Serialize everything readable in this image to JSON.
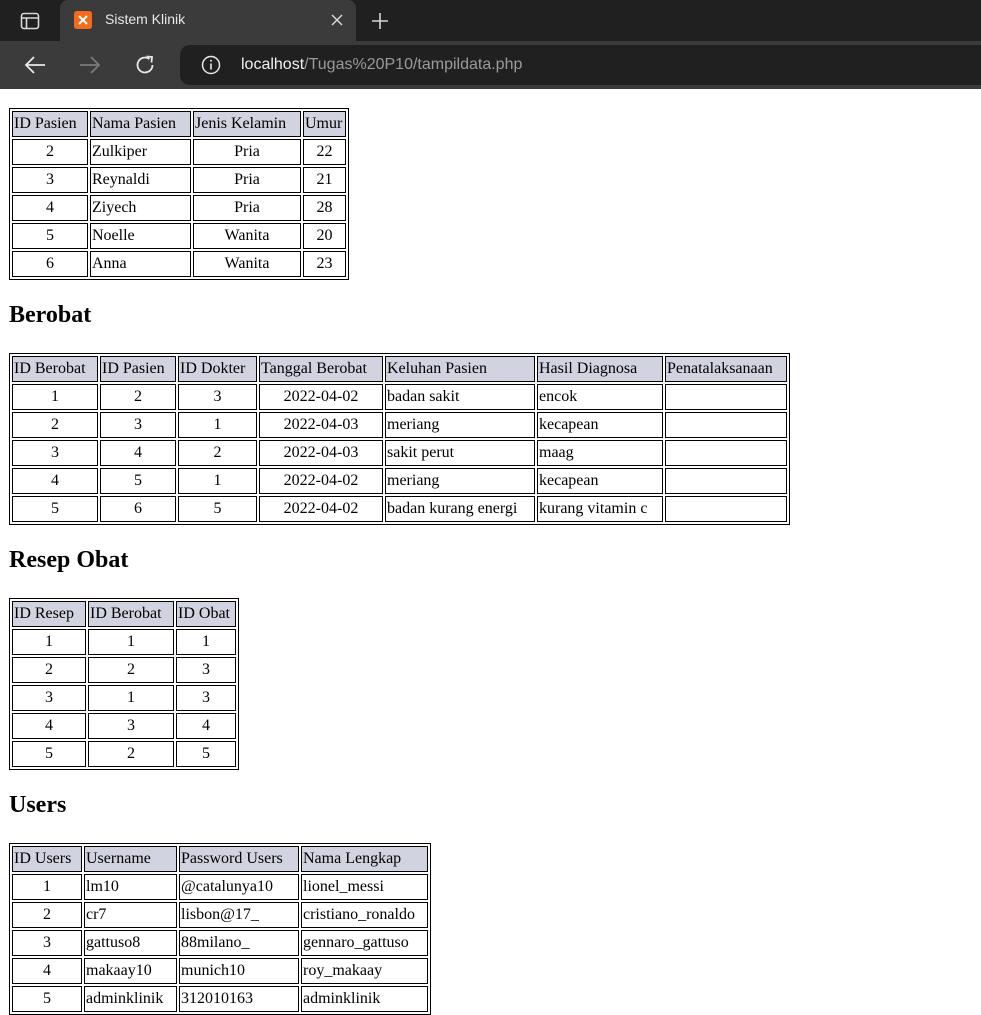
{
  "browser": {
    "tab_title": "Sistem Klinik",
    "url_host": "localhost",
    "url_path": "/Tugas%20P10/tampildata.php",
    "favicon_text": "ꭚ"
  },
  "pasien": {
    "headers": [
      "ID Pasien",
      "Nama Pasien",
      "Jenis Kelamin",
      "Umur"
    ],
    "rows": [
      [
        "2",
        "Zulkiper",
        "Pria",
        "22"
      ],
      [
        "3",
        "Reynaldi",
        "Pria",
        "21"
      ],
      [
        "4",
        "Ziyech",
        "Pria",
        "28"
      ],
      [
        "5",
        "Noelle",
        "Wanita",
        "20"
      ],
      [
        "6",
        "Anna",
        "Wanita",
        "23"
      ]
    ]
  },
  "berobat": {
    "title": "Berobat",
    "headers": [
      "ID Berobat",
      "ID Pasien",
      "ID Dokter",
      "Tanggal Berobat",
      "Keluhan Pasien",
      "Hasil Diagnosa",
      "Penatalaksanaan"
    ],
    "rows": [
      [
        "1",
        "2",
        "3",
        "2022-04-02",
        "badan sakit",
        "encok",
        ""
      ],
      [
        "2",
        "3",
        "1",
        "2022-04-03",
        "meriang",
        "kecapean",
        ""
      ],
      [
        "3",
        "4",
        "2",
        "2022-04-03",
        "sakit perut",
        "maag",
        ""
      ],
      [
        "4",
        "5",
        "1",
        "2022-04-02",
        "meriang",
        "kecapean",
        ""
      ],
      [
        "5",
        "6",
        "5",
        "2022-04-02",
        "badan kurang energi",
        "kurang vitamin c",
        ""
      ]
    ]
  },
  "resep": {
    "title": "Resep Obat",
    "headers": [
      "ID Resep",
      "ID Berobat",
      "ID Obat"
    ],
    "rows": [
      [
        "1",
        "1",
        "1"
      ],
      [
        "2",
        "2",
        "3"
      ],
      [
        "3",
        "1",
        "3"
      ],
      [
        "4",
        "3",
        "4"
      ],
      [
        "5",
        "2",
        "5"
      ]
    ]
  },
  "users": {
    "title": "Users",
    "headers": [
      "ID Users",
      "Username",
      "Password Users",
      "Nama Lengkap"
    ],
    "rows": [
      [
        "1",
        "lm10",
        "@catalunya10",
        "lionel_messi"
      ],
      [
        "2",
        "cr7",
        "lisbon@17_",
        "cristiano_ronaldo"
      ],
      [
        "3",
        "gattuso8",
        "88milano_",
        "gennaro_gattuso"
      ],
      [
        "4",
        "makaay10",
        "munich10",
        "roy_makaay"
      ],
      [
        "5",
        "adminklinik",
        "312010163",
        "adminklinik"
      ]
    ]
  }
}
